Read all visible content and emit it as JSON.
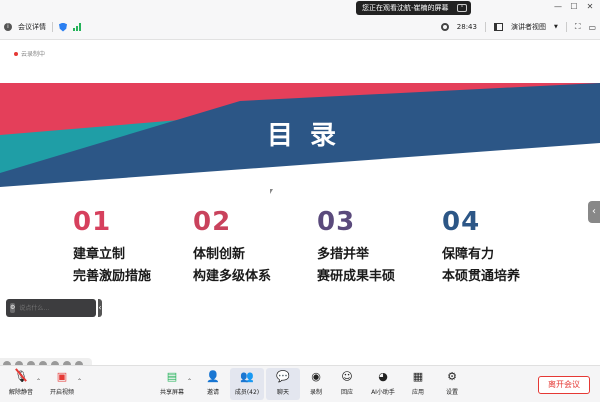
{
  "topbar": {
    "notice": "您正在观看沈航-崔楠的屏幕",
    "meeting_details": "会议详情",
    "time": "28:43",
    "view_mode": "演讲者视图",
    "view_caret": "▼"
  },
  "stage": {
    "recording": "云录制中",
    "title": "目 录",
    "colors": {
      "red": "#e43f5a",
      "teal": "#1f9ea6",
      "navy": "#2c5686"
    },
    "items": [
      {
        "num": "01",
        "line1": "建章立制",
        "line2": "完善激励措施",
        "color": "#d6405d"
      },
      {
        "num": "02",
        "line1": "体制创新",
        "line2": "构建多级体系",
        "color": "#c9425c"
      },
      {
        "num": "03",
        "line1": "多措并举",
        "line2": "赛研成果丰硕",
        "color": "#5a4a7c"
      },
      {
        "num": "04",
        "line1": "保障有力",
        "line2": "本硕贯通培养",
        "color": "#2c5686"
      }
    ],
    "chat_placeholder": "说点什么…"
  },
  "toolbar": {
    "unmute": "解除静音",
    "video": "开启视频",
    "share": "共享屏幕",
    "invite": "邀请",
    "members": "成员(42)",
    "chat": "聊天",
    "record": "录制",
    "react": "回应",
    "ai": "AI小助手",
    "apps": "应用",
    "settings": "设置",
    "leave": "离开会议"
  }
}
